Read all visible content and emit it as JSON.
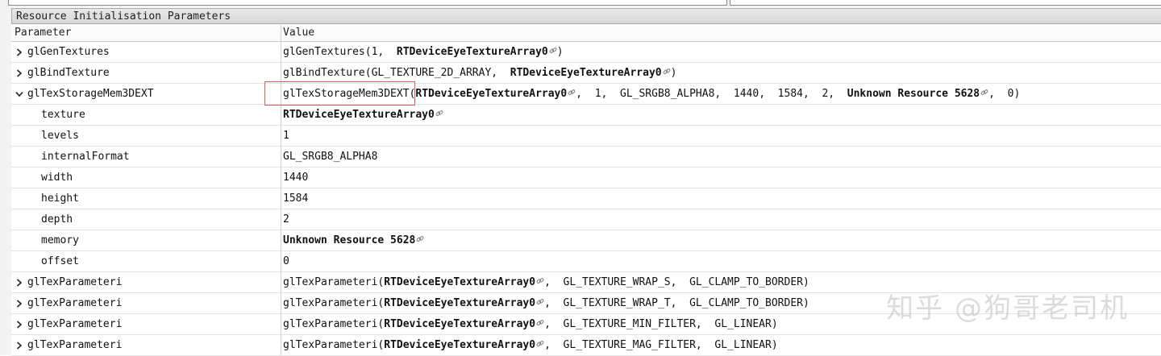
{
  "panel": {
    "title": "Resource Initialisation Parameters"
  },
  "columns": {
    "parameter": "Parameter",
    "value": "Value"
  },
  "rows": [
    {
      "kind": "collapsed",
      "param": "glGenTextures",
      "value_parts": [
        {
          "t": "glGenTextures(1,  "
        },
        {
          "t": "RTDeviceEyeTextureArray0",
          "bold": true,
          "link": true
        },
        {
          "t": ")"
        }
      ]
    },
    {
      "kind": "collapsed",
      "param": "glBindTexture",
      "value_parts": [
        {
          "t": "glBindTexture(GL_TEXTURE_2D_ARRAY,  "
        },
        {
          "t": "RTDeviceEyeTextureArray0",
          "bold": true,
          "link": true
        },
        {
          "t": ")"
        }
      ]
    },
    {
      "kind": "expanded",
      "param": "glTexStorageMem3DEXT",
      "value_parts": [
        {
          "t": "glTexStorageMem3DEXT("
        },
        {
          "t": "RTDeviceEyeTextureArray0",
          "bold": true,
          "link": true
        },
        {
          "t": ",  1,  GL_SRGB8_ALPHA8,  1440,  1584,  2,  "
        },
        {
          "t": "Unknown Resource 5628",
          "bold": true,
          "link": true
        },
        {
          "t": ",  0)"
        }
      ]
    },
    {
      "kind": "child",
      "param": "texture",
      "value_parts": [
        {
          "t": "RTDeviceEyeTextureArray0",
          "bold": true,
          "link": true
        }
      ]
    },
    {
      "kind": "child",
      "param": "levels",
      "value_parts": [
        {
          "t": "1"
        }
      ]
    },
    {
      "kind": "child",
      "param": "internalFormat",
      "value_parts": [
        {
          "t": "GL_SRGB8_ALPHA8"
        }
      ]
    },
    {
      "kind": "child",
      "param": "width",
      "value_parts": [
        {
          "t": "1440"
        }
      ]
    },
    {
      "kind": "child",
      "param": "height",
      "value_parts": [
        {
          "t": "1584"
        }
      ]
    },
    {
      "kind": "child",
      "param": "depth",
      "value_parts": [
        {
          "t": "2"
        }
      ]
    },
    {
      "kind": "child",
      "param": "memory",
      "value_parts": [
        {
          "t": "Unknown Resource 5628",
          "bold": true,
          "link": true
        }
      ]
    },
    {
      "kind": "child",
      "param": "offset",
      "value_parts": [
        {
          "t": "0"
        }
      ]
    },
    {
      "kind": "collapsed",
      "param": "glTexParameteri",
      "value_parts": [
        {
          "t": "glTexParameteri("
        },
        {
          "t": "RTDeviceEyeTextureArray0",
          "bold": true,
          "link": true
        },
        {
          "t": ",  GL_TEXTURE_WRAP_S,  GL_CLAMP_TO_BORDER)"
        }
      ]
    },
    {
      "kind": "collapsed",
      "param": "glTexParameteri",
      "value_parts": [
        {
          "t": "glTexParameteri("
        },
        {
          "t": "RTDeviceEyeTextureArray0",
          "bold": true,
          "link": true
        },
        {
          "t": ",  GL_TEXTURE_WRAP_T,  GL_CLAMP_TO_BORDER)"
        }
      ]
    },
    {
      "kind": "collapsed",
      "param": "glTexParameteri",
      "value_parts": [
        {
          "t": "glTexParameteri("
        },
        {
          "t": "RTDeviceEyeTextureArray0",
          "bold": true,
          "link": true
        },
        {
          "t": ",  GL_TEXTURE_MIN_FILTER,  GL_LINEAR)"
        }
      ]
    },
    {
      "kind": "collapsed",
      "param": "glTexParameteri",
      "value_parts": [
        {
          "t": "glTexParameteri("
        },
        {
          "t": "RTDeviceEyeTextureArray0",
          "bold": true,
          "link": true
        },
        {
          "t": ",  GL_TEXTURE_MAG_FILTER,  GL_LINEAR)"
        }
      ]
    }
  ],
  "watermark": "知乎 @狗哥老司机",
  "colors": {
    "highlight_border": "#e05a5a",
    "header_bg": "#d7d7d7"
  }
}
